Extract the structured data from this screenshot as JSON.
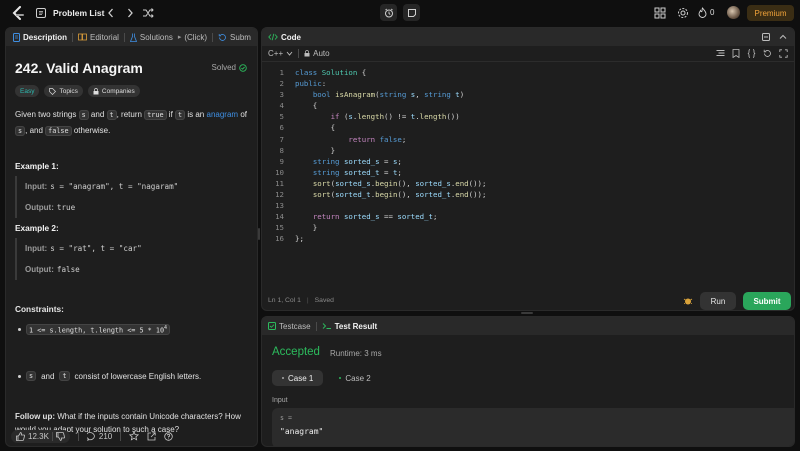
{
  "topbar": {
    "problem_list": "Problem List",
    "streak_count": "0",
    "premium": "Premium"
  },
  "left_tabs": {
    "description": "Description",
    "editorial": "Editorial",
    "solutions": "Solutions",
    "click": "(Click)",
    "submissions": "Subm"
  },
  "problem": {
    "title": "242. Valid Anagram",
    "status": "Solved",
    "difficulty": "Easy",
    "topics": "Topics",
    "companies": "Companies",
    "statement_p1": "Given two strings",
    "chip_s": "s",
    "and": "and",
    "chip_t": "t",
    "statement_p2": ", return",
    "chip_true": "true",
    "if_word": "if",
    "chip_t2": "t",
    "is_an": "is an",
    "anagram": "anagram",
    "of_word": "of",
    "chip_s2": "s",
    "comma_and": ",",
    "and_word": "and",
    "chip_false": "false",
    "otherwise": "otherwise."
  },
  "examples": [
    {
      "title": "Example 1:",
      "input_label": "Input:",
      "input": "s = \"anagram\", t = \"nagaram\"",
      "output_label": "Output:",
      "output": "true"
    },
    {
      "title": "Example 2:",
      "input_label": "Input:",
      "input": "s = \"rat\", t = \"car\"",
      "output_label": "Output:",
      "output": "false"
    }
  ],
  "constraints": {
    "title": "Constraints:",
    "c1": "1 <= s.length, t.length <= 5 * 10",
    "c1_exp": "4",
    "c2_s": "s",
    "c2_and": "and",
    "c2_t": "t",
    "c2_rest": "consist of lowercase English letters."
  },
  "followup": {
    "label": "Follow up:",
    "text": "What if the inputs contain Unicode characters? How would you adapt your solution to such a case?"
  },
  "left_footer": {
    "likes": "12.3K",
    "comments": "210"
  },
  "code_panel": {
    "title": "Code",
    "language": "C++",
    "mode": "Auto",
    "status_pos": "Ln 1, Col 1",
    "status_saved": "Saved",
    "run": "Run",
    "submit": "Submit"
  },
  "test_panel": {
    "testcase": "Testcase",
    "result": "Test Result",
    "accepted": "Accepted",
    "runtime": "Runtime: 3 ms",
    "case1": "Case 1",
    "case2": "Case 2",
    "input_label": "Input",
    "input_name": "s =",
    "input_value": "\"anagram\""
  },
  "code_lines": [
    "class Solution {",
    "public:",
    "    bool isAnagram(string s, string t)",
    "    {",
    "        if (s.length() != t.length())",
    "        {",
    "            return false;",
    "        }",
    "    string sorted_s = s;",
    "    string sorted_t = t;",
    "    sort(sorted_s.begin(), sorted_s.end());",
    "    sort(sorted_t.begin(), sorted_t.end());",
    "",
    "    return sorted_s == sorted_t;",
    "    }",
    "};"
  ],
  "colors": {
    "accent_green": "#2cbb5d",
    "submit_green": "#2aa65b",
    "easy_teal": "#2cbbb0",
    "premium_orange": "#f2a43a",
    "link_blue": "#3f8fe3"
  }
}
